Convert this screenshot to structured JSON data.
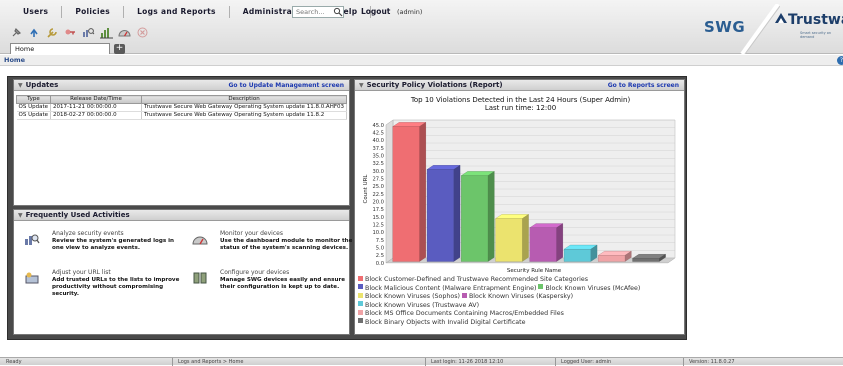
{
  "menu": {
    "items": [
      "Users",
      "Policies",
      "Logs and Reports",
      "Administration",
      "Help"
    ],
    "search_placeholder": "Search...",
    "logout_label": "Logout",
    "user_label": "(admin)"
  },
  "toolbar": {
    "icons": [
      "pin-icon",
      "refresh-icon",
      "wrench-icon",
      "key-icon",
      "magnifier-bars-icon",
      "bar-chart-icon",
      "dashboard-gauge-icon",
      "close-circle-icon"
    ]
  },
  "tabs": {
    "home_label": "Home",
    "add_label": "+"
  },
  "brand": {
    "product": "SWG",
    "company": "Trustwave",
    "tagline": "Smart security on demand"
  },
  "breadcrumb": {
    "label": "Home"
  },
  "updates": {
    "title": "Updates",
    "link": "Go to Update Management screen",
    "columns": [
      "Type",
      "Release Date/Time",
      "Description"
    ],
    "rows": [
      [
        "OS Update",
        "2017-11-21 00:00:00.0",
        "Trustwave Secure Web Gateway Operating System update 11.8.0.AHF03"
      ],
      [
        "OS Update",
        "2018-02-27 00:00:00.0",
        "Trustwave Secure Web Gateway Operating System update 11.8.2"
      ]
    ]
  },
  "activities": {
    "title": "Frequently Used Activities",
    "items": [
      {
        "title": "Analyze security events",
        "desc": "Review the system's generated logs in one view to analyze events.",
        "icon": "analyze-icon"
      },
      {
        "title": "Monitor your devices",
        "desc": "Use the dashboard module to monitor the status of the system's scanning devices.",
        "icon": "gauge-icon"
      },
      {
        "title": "Adjust your URL list",
        "desc": "Add trusted URLs to the lists to improve productivity without compromising security.",
        "icon": "url-list-icon"
      },
      {
        "title": "Configure your devices",
        "desc": "Manage SWG devices easily and ensure their configuration is kept up to date.",
        "icon": "devices-icon"
      }
    ]
  },
  "violations": {
    "title": "Security Policy Violations (Report)",
    "link": "Go to Reports screen"
  },
  "chart_data": {
    "type": "bar",
    "title": "Top 10 Violations Detected in the Last 24 Hours (Super Admin)",
    "subtitle": "Last run time: 12:00",
    "xlabel": "Security Rule Name",
    "ylabel": "Count URL",
    "ylim": [
      0,
      45
    ],
    "yticks": [
      "0.0",
      "2.5",
      "5.0",
      "7.5",
      "10.0",
      "12.5",
      "15.0",
      "17.5",
      "20.0",
      "22.5",
      "25.0",
      "27.5",
      "30.0",
      "32.5",
      "35.0",
      "37.5",
      "40.0",
      "42.5",
      "45.0"
    ],
    "grid": true,
    "legend_position": "bottom",
    "categories": [
      "Block Customer-Defined and Trustwave Recommended Site Categories",
      "Block Malicious Content (Malware Entrapment Engine)",
      "Block Known Viruses (McAfee)",
      "Block Known Viruses (Sophos)",
      "Block Known Viruses (Kaspersky)",
      "Block Known Viruses (Trustwave AV)",
      "Block MS Office Documents  Containing Macros/Embedded Files",
      "Block Binary Objects with Invalid Digital Certificate"
    ],
    "values": [
      44,
      30,
      28,
      14,
      11,
      4,
      2,
      1
    ],
    "colors": [
      "#ef6e72",
      "#5a5cc0",
      "#6cc56a",
      "#ebe36e",
      "#b75cb1",
      "#5ec9d8",
      "#f0a3a6",
      "#707070"
    ],
    "legend_rows": [
      [
        0
      ],
      [
        1,
        2
      ],
      [
        3,
        4
      ],
      [
        5
      ],
      [
        6
      ],
      [
        7
      ]
    ]
  },
  "statusbar": {
    "segments": [
      "Ready",
      "Logs and Reports > Home",
      "Last login: 11-26 2018 12:10",
      "Logged User: admin",
      "Version: 11.8.0.27"
    ]
  }
}
